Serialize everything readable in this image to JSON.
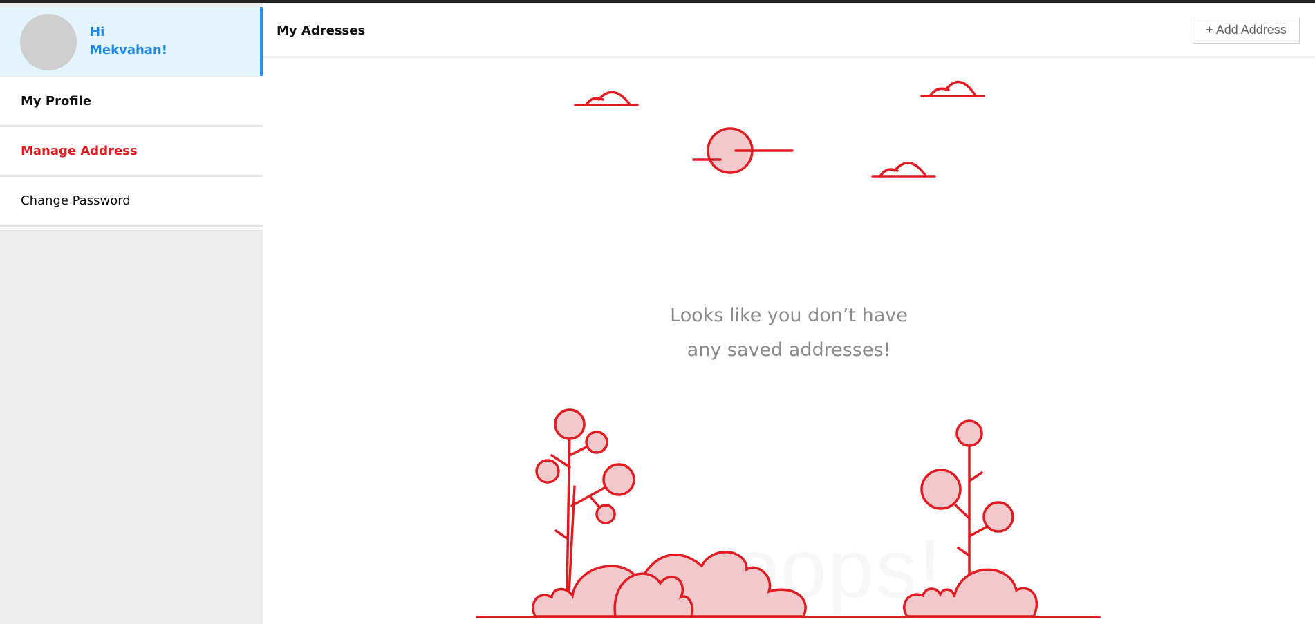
{
  "sidebar": {
    "greeting_hi": "Hi",
    "greeting_name": "Mekvahan!",
    "items": [
      {
        "label": "My Profile"
      },
      {
        "label": "Manage Address"
      },
      {
        "label": "Change Password"
      }
    ]
  },
  "main": {
    "title": "My Adresses",
    "add_button": "+ Add Address",
    "empty_line1": "Looks like you don’t have",
    "empty_line2": "any saved addresses!",
    "watermark": "oops!"
  },
  "colors": {
    "accent": "#e11b22",
    "highlight": "#2196f3",
    "illustration_fill": "#f1c9cc"
  }
}
